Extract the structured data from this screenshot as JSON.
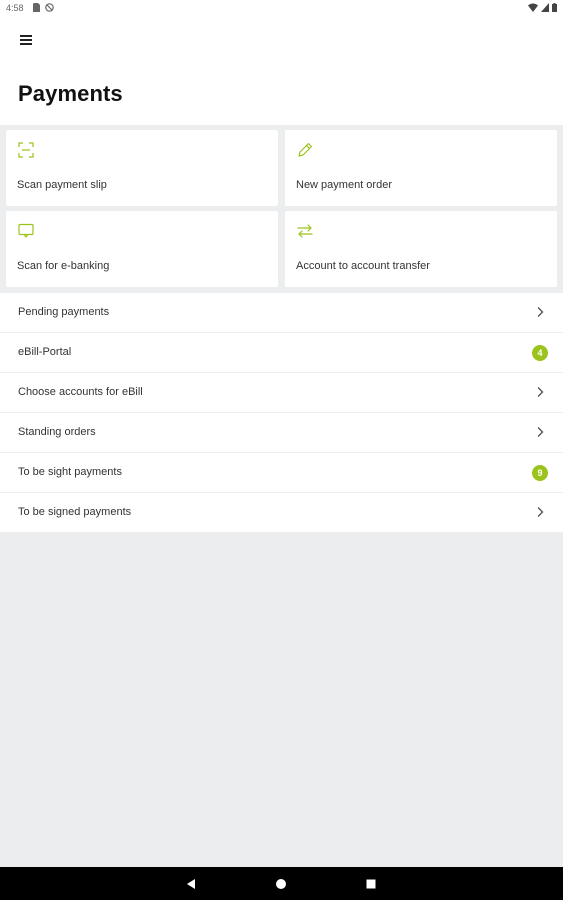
{
  "status_bar": {
    "time": "4:58"
  },
  "header": {
    "title": "Payments"
  },
  "tiles": [
    {
      "label": "Scan payment slip",
      "icon": "scan-icon"
    },
    {
      "label": "New payment order",
      "icon": "pencil-icon"
    },
    {
      "label": "Scan for e-banking",
      "icon": "monitor-icon"
    },
    {
      "label": "Account to account transfer",
      "icon": "transfer-arrows-icon"
    }
  ],
  "list": [
    {
      "label": "Pending payments",
      "trailing": "chevron"
    },
    {
      "label": "eBill-Portal",
      "trailing": "badge",
      "badge": "4"
    },
    {
      "label": "Choose accounts for eBill",
      "trailing": "chevron"
    },
    {
      "label": "Standing orders",
      "trailing": "chevron"
    },
    {
      "label": "To be sight payments",
      "trailing": "badge",
      "badge": "9"
    },
    {
      "label": "To be signed payments",
      "trailing": "chevron"
    }
  ],
  "colors": {
    "accent": "#9BC31C",
    "background": "#ECEDEE",
    "surface": "#FFFFFF",
    "nav_bar": "#000000"
  }
}
